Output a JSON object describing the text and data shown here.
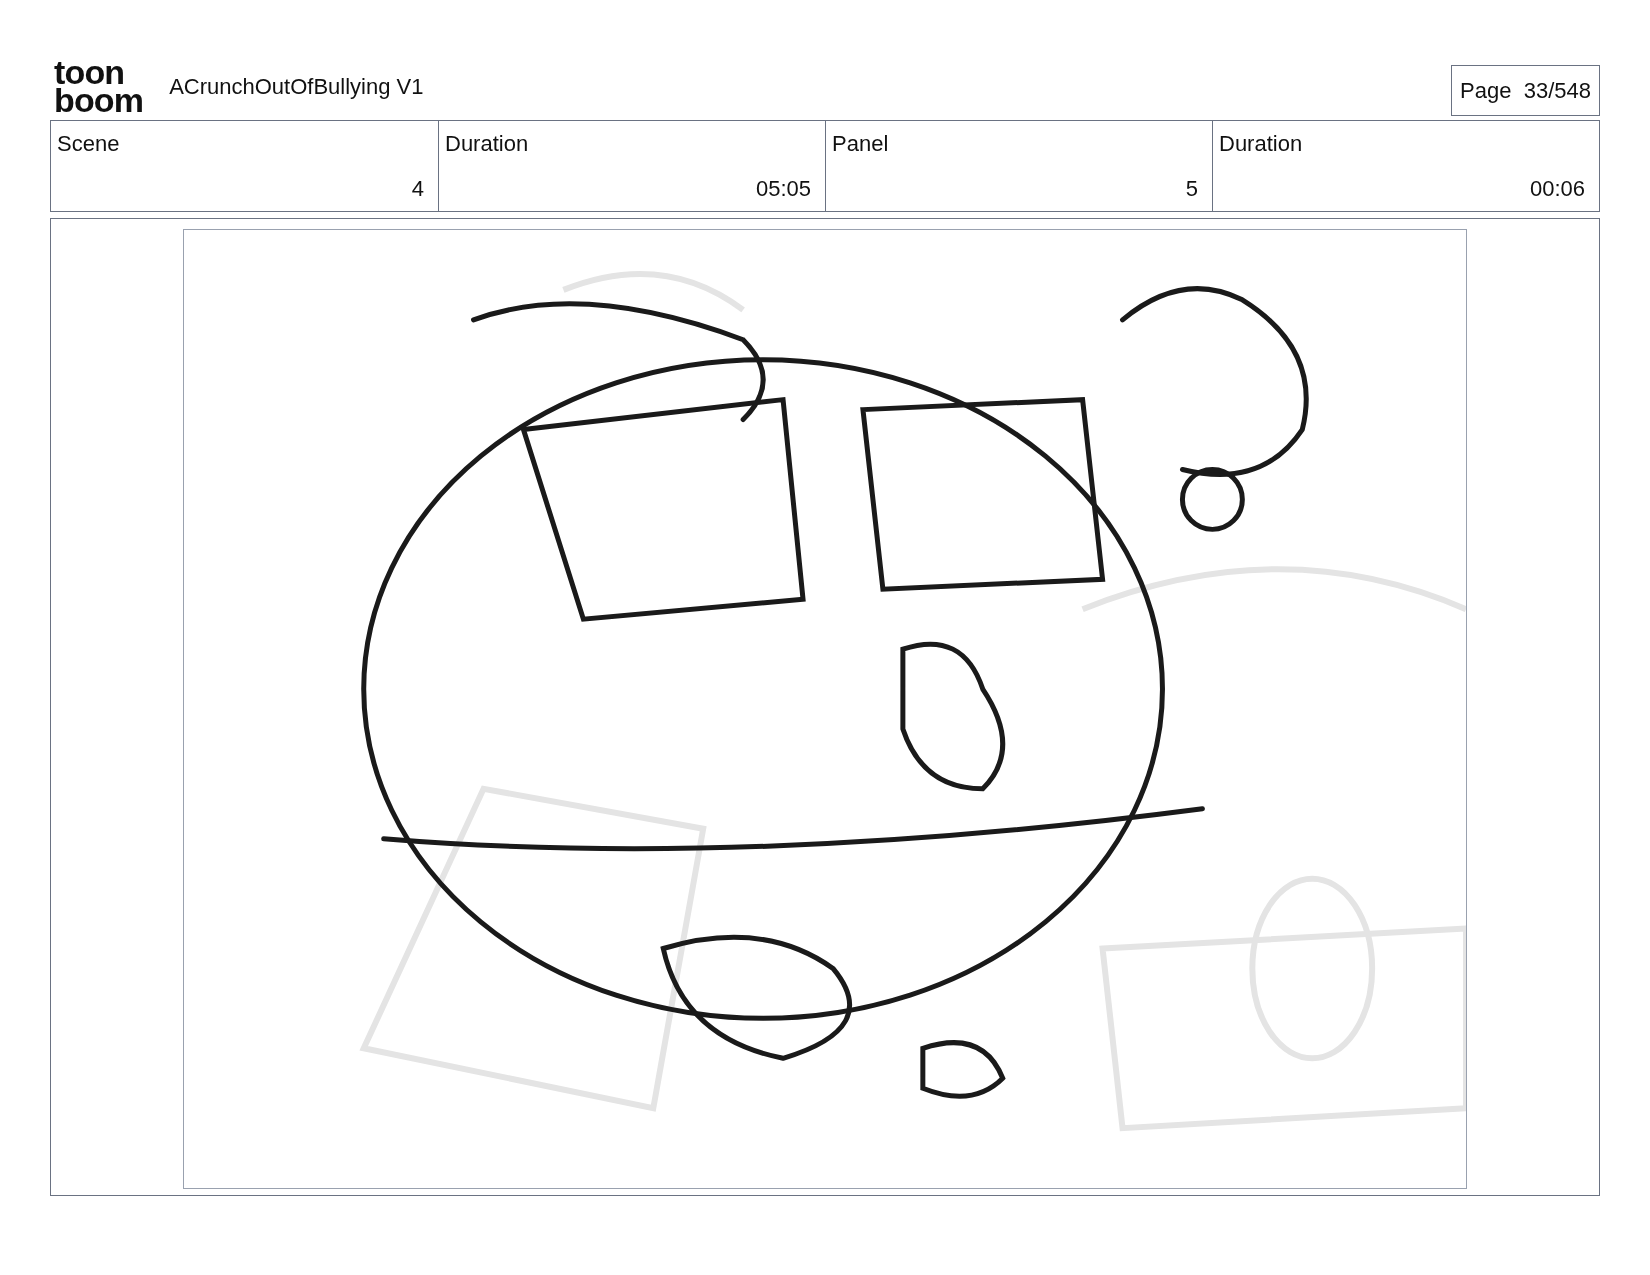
{
  "header": {
    "logo": [
      "toon",
      "boom"
    ],
    "project": "ACrunchOutOfBullying V1",
    "page": "Page  33/548"
  },
  "fields": [
    {
      "label": "Scene",
      "value": "4"
    },
    {
      "label": "Duration",
      "value": "05:05"
    },
    {
      "label": "Panel",
      "value": "5"
    },
    {
      "label": "Duration",
      "value": "00:06"
    }
  ],
  "panel": {
    "kind": "sketch"
  }
}
